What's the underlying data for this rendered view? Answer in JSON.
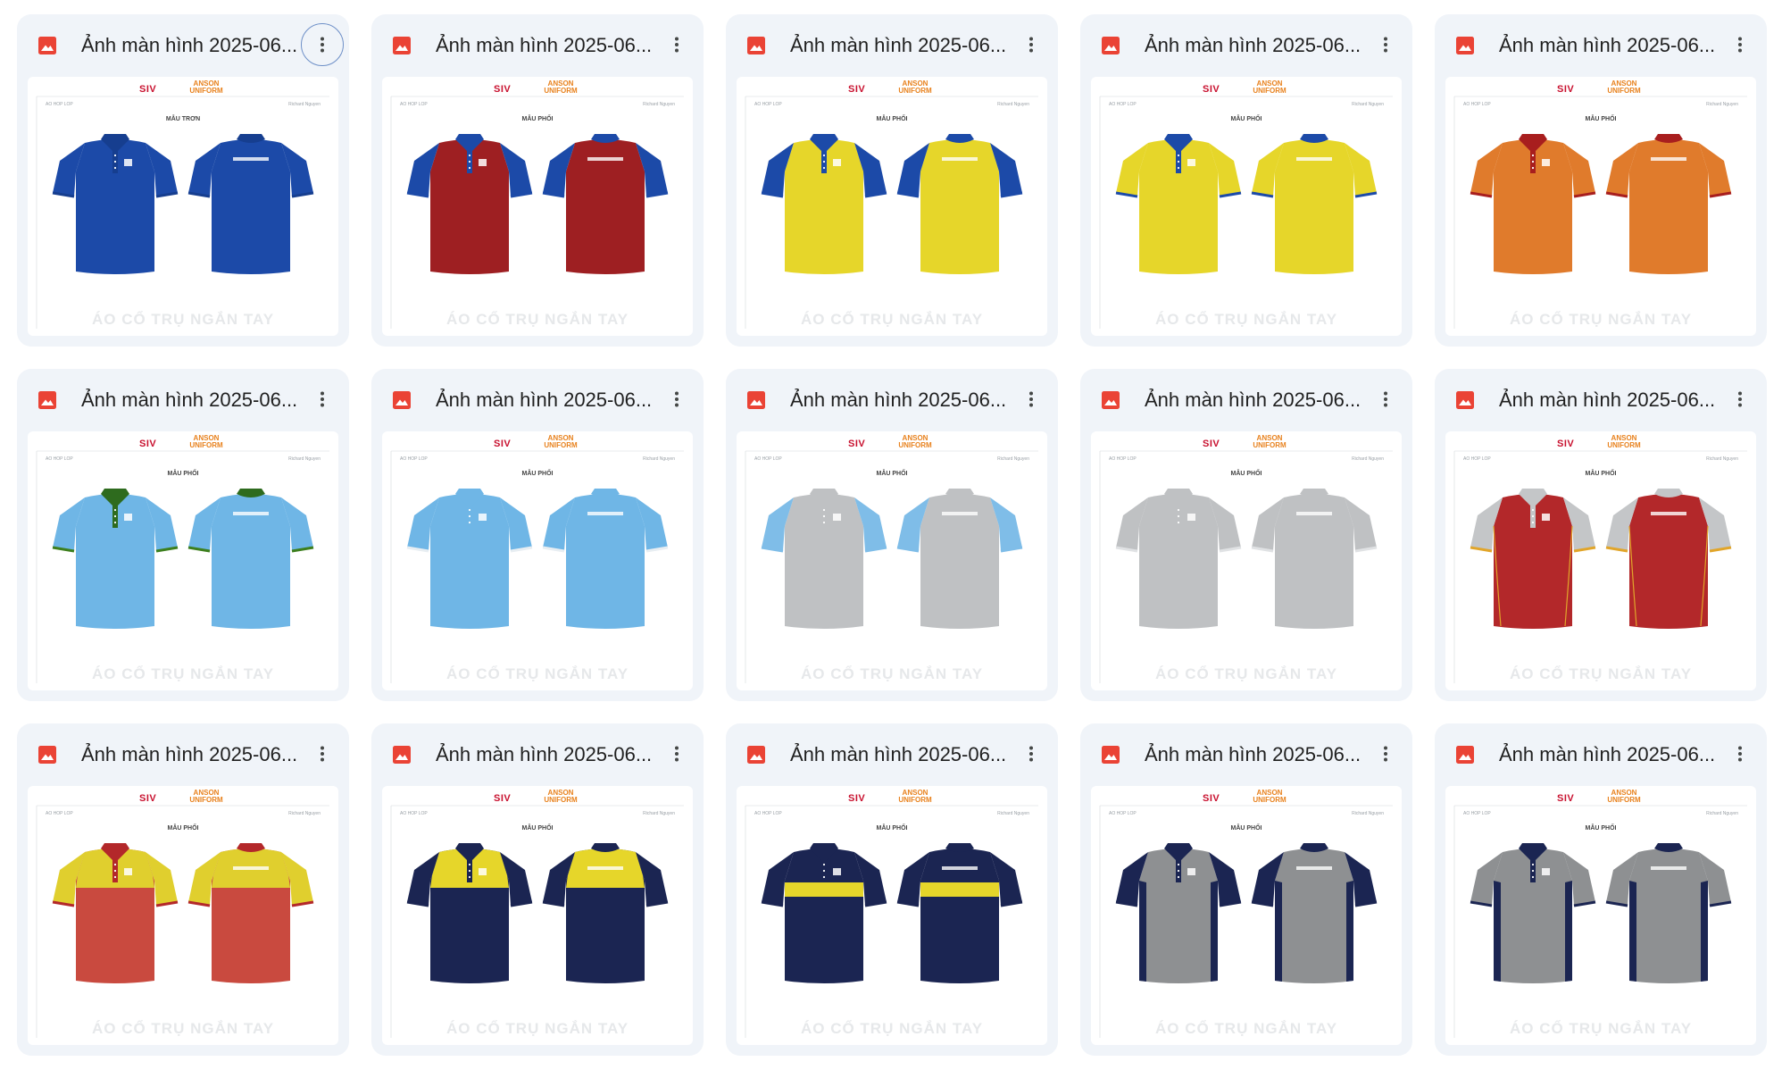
{
  "cards": [
    {
      "title": "Ảnh màn hình 2025-06...",
      "brand_left": "SIV",
      "brand_right": "ANSON UNIFORM",
      "sub_left": "AO HOP LOP",
      "sub_right": "Richard Nguyen",
      "design_label": "MẪU TRƠN",
      "watermark": "ÁO CỔ TRỤ NGẮN TAY",
      "menu_focused": true,
      "colors": {
        "body": "#1c4aa8",
        "sleeve": "#1c4aa8",
        "collar": "#163e8f",
        "trim": "#163e8f",
        "panel": "#1c4aa8"
      },
      "style": "plain"
    },
    {
      "title": "Ảnh màn hình 2025-06...",
      "brand_left": "SIV",
      "brand_right": "ANSON UNIFORM",
      "sub_left": "AO HOP LOP",
      "sub_right": "Richard Nguyen",
      "design_label": "MẪU PHỐI",
      "watermark": "ÁO CỔ TRỤ NGẮN TAY",
      "menu_focused": false,
      "colors": {
        "body": "#9e1f22",
        "sleeve": "#1c4aa8",
        "collar": "#1c4aa8",
        "trim": "#1c4aa8",
        "panel": "#9e1f22"
      },
      "style": "sleeve"
    },
    {
      "title": "Ảnh màn hình 2025-06...",
      "brand_left": "SIV",
      "brand_right": "ANSON UNIFORM",
      "sub_left": "AO HOP LOP",
      "sub_right": "Richard Nguyen",
      "design_label": "MẪU PHỐI",
      "watermark": "ÁO CỔ TRỤ NGẮN TAY",
      "menu_focused": false,
      "colors": {
        "body": "#e6d62a",
        "sleeve": "#1c4aa8",
        "collar": "#1c4aa8",
        "trim": "#1c4aa8",
        "panel": "#e6d62a"
      },
      "style": "sleeve"
    },
    {
      "title": "Ảnh màn hình 2025-06...",
      "brand_left": "SIV",
      "brand_right": "ANSON UNIFORM",
      "sub_left": "AO HOP LOP",
      "sub_right": "Richard Nguyen",
      "design_label": "MẪU PHỐI",
      "watermark": "ÁO CỔ TRỤ NGẮN TAY",
      "menu_focused": false,
      "colors": {
        "body": "#e6d62a",
        "sleeve": "#e6d62a",
        "collar": "#1c4aa8",
        "trim": "#1c4aa8",
        "panel": "#e6d62a"
      },
      "style": "trim"
    },
    {
      "title": "Ảnh màn hình 2025-06...",
      "brand_left": "SIV",
      "brand_right": "ANSON UNIFORM",
      "sub_left": "AO HOP LOP",
      "sub_right": "Richard Nguyen",
      "design_label": "MẪU PHỐI",
      "watermark": "ÁO CỔ TRỤ NGẮN TAY",
      "menu_focused": false,
      "colors": {
        "body": "#e07b2c",
        "sleeve": "#e07b2c",
        "collar": "#a81e1e",
        "trim": "#a81e1e",
        "panel": "#e07b2c"
      },
      "style": "trim"
    },
    {
      "title": "Ảnh màn hình 2025-06...",
      "brand_left": "SIV",
      "brand_right": "ANSON UNIFORM",
      "sub_left": "AO HOP LOP",
      "sub_right": "Richard Nguyen",
      "design_label": "MẪU PHỐI",
      "watermark": "ÁO CỔ TRỤ NGẮN TAY",
      "menu_focused": false,
      "colors": {
        "body": "#6fb6e6",
        "sleeve": "#6fb6e6",
        "collar": "#2e6b1e",
        "trim": "#3d7f1e",
        "panel": "#6fb6e6"
      },
      "style": "trim"
    },
    {
      "title": "Ảnh màn hình 2025-06...",
      "brand_left": "SIV",
      "brand_right": "ANSON UNIFORM",
      "sub_left": "AO HOP LOP",
      "sub_right": "Richard Nguyen",
      "design_label": "MẪU PHỐI",
      "watermark": "ÁO CỔ TRỤ NGẮN TAY",
      "menu_focused": false,
      "colors": {
        "body": "#6fb6e6",
        "sleeve": "#6fb6e6",
        "collar": "#6fb6e6",
        "trim": "#e8eef2",
        "panel": "#6fb6e6"
      },
      "style": "trim"
    },
    {
      "title": "Ảnh màn hình 2025-06...",
      "brand_left": "SIV",
      "brand_right": "ANSON UNIFORM",
      "sub_left": "AO HOP LOP",
      "sub_right": "Richard Nguyen",
      "design_label": "MẪU PHỐI",
      "watermark": "ÁO CỔ TRỤ NGẮN TAY",
      "menu_focused": false,
      "colors": {
        "body": "#bfc1c3",
        "sleeve": "#7fbde8",
        "collar": "#bfc1c3",
        "trim": "#7fbde8",
        "panel": "#bfc1c3"
      },
      "style": "sleeve"
    },
    {
      "title": "Ảnh màn hình 2025-06...",
      "brand_left": "SIV",
      "brand_right": "ANSON UNIFORM",
      "sub_left": "AO HOP LOP",
      "sub_right": "Richard Nguyen",
      "design_label": "MẪU PHỐI",
      "watermark": "ÁO CỔ TRỤ NGẮN TAY",
      "menu_focused": false,
      "colors": {
        "body": "#bfc1c3",
        "sleeve": "#bfc1c3",
        "collar": "#bfc1c3",
        "trim": "#e0e2e4",
        "panel": "#bfc1c3"
      },
      "style": "trim"
    },
    {
      "title": "Ảnh màn hình 2025-06...",
      "brand_left": "SIV",
      "brand_right": "ANSON UNIFORM",
      "sub_left": "AO HOP LOP",
      "sub_right": "Richard Nguyen",
      "design_label": "MẪU PHỐI",
      "watermark": "ÁO CỔ TRỤ NGẮN TAY",
      "menu_focused": false,
      "colors": {
        "body": "#b3282a",
        "sleeve": "#c4c6c8",
        "collar": "#c4c6c8",
        "trim": "#e1a52a",
        "panel": "#b3282a"
      },
      "style": "sleeve"
    },
    {
      "title": "Ảnh màn hình 2025-06...",
      "brand_left": "SIV",
      "brand_right": "ANSON UNIFORM",
      "sub_left": "AO HOP LOP",
      "sub_right": "Richard Nguyen",
      "design_label": "MẪU PHỐI",
      "watermark": "ÁO CỔ TRỤ NGẮN TAY",
      "menu_focused": false,
      "colors": {
        "body": "#c94a3f",
        "sleeve": "#e0cf2e",
        "collar": "#b3282a",
        "trim": "#b3282a",
        "panel": "#e0cf2e"
      },
      "style": "yoke"
    },
    {
      "title": "Ảnh màn hình 2025-06...",
      "brand_left": "SIV",
      "brand_right": "ANSON UNIFORM",
      "sub_left": "AO HOP LOP",
      "sub_right": "Richard Nguyen",
      "design_label": "MẪU PHỐI",
      "watermark": "ÁO CỔ TRỤ NGẮN TAY",
      "menu_focused": false,
      "colors": {
        "body": "#1b2552",
        "sleeve": "#1b2552",
        "collar": "#1b2552",
        "trim": "#1b2552",
        "panel": "#e6d62a"
      },
      "style": "yoke"
    },
    {
      "title": "Ảnh màn hình 2025-06...",
      "brand_left": "SIV",
      "brand_right": "ANSON UNIFORM",
      "sub_left": "AO HOP LOP",
      "sub_right": "Richard Nguyen",
      "design_label": "MẪU PHỐI",
      "watermark": "ÁO CỔ TRỤ NGẮN TAY",
      "menu_focused": false,
      "colors": {
        "body": "#1b2552",
        "sleeve": "#1b2552",
        "collar": "#1b2552",
        "trim": "#1b2552",
        "panel": "#e6d62a"
      },
      "style": "band"
    },
    {
      "title": "Ảnh màn hình 2025-06...",
      "brand_left": "SIV",
      "brand_right": "ANSON UNIFORM",
      "sub_left": "AO HOP LOP",
      "sub_right": "Richard Nguyen",
      "design_label": "MẪU PHỐI",
      "watermark": "ÁO CỔ TRỤ NGẮN TAY",
      "menu_focused": false,
      "colors": {
        "body": "#8e9092",
        "sleeve": "#1b2552",
        "collar": "#1b2552",
        "trim": "#1b2552",
        "panel": "#8e9092"
      },
      "style": "side"
    },
    {
      "title": "Ảnh màn hình 2025-06...",
      "brand_left": "SIV",
      "brand_right": "ANSON UNIFORM",
      "sub_left": "AO HOP LOP",
      "sub_right": "Richard Nguyen",
      "design_label": "MẪU PHỐI",
      "watermark": "ÁO CỔ TRỤ NGẮN TAY",
      "menu_focused": false,
      "colors": {
        "body": "#8e9092",
        "sleeve": "#8e9092",
        "collar": "#1b2552",
        "trim": "#1b2552",
        "panel": "#8e9092"
      },
      "style": "side"
    }
  ]
}
